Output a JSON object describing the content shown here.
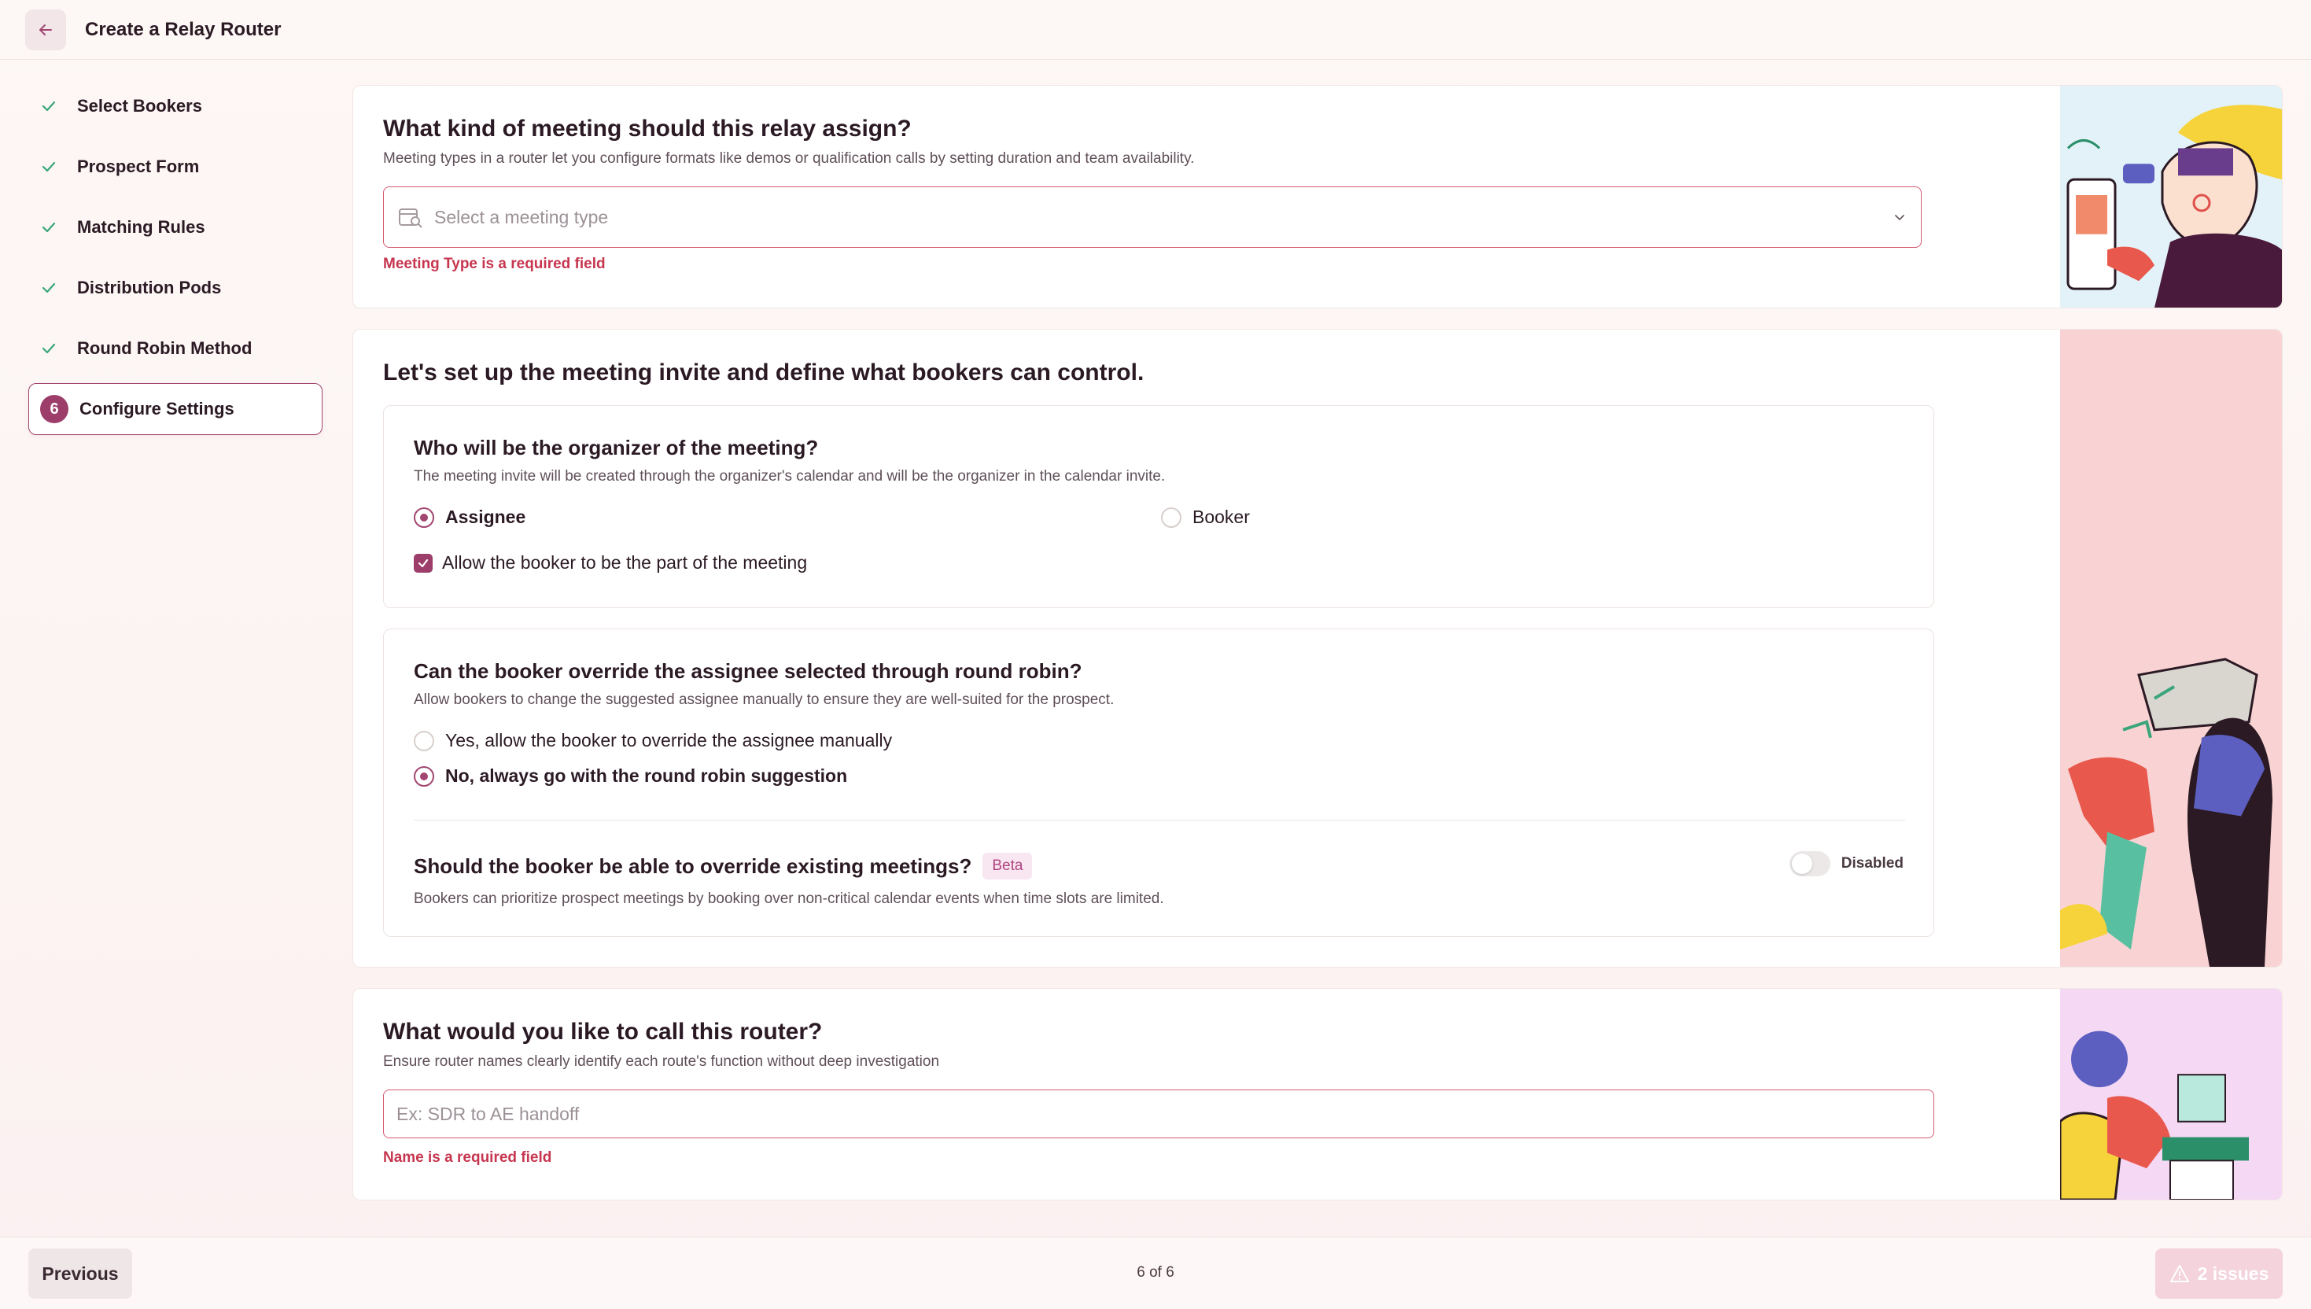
{
  "header": {
    "title": "Create a Relay Router"
  },
  "sidebar": {
    "steps": [
      {
        "label": "Select Bookers",
        "status": "done"
      },
      {
        "label": "Prospect Form",
        "status": "done"
      },
      {
        "label": "Matching Rules",
        "status": "done"
      },
      {
        "label": "Distribution Pods",
        "status": "done"
      },
      {
        "label": "Round Robin Method",
        "status": "done"
      },
      {
        "label": "Configure Settings",
        "status": "active",
        "number": "6"
      }
    ]
  },
  "meeting_type": {
    "title": "What kind of meeting should this relay assign?",
    "subtitle": "Meeting types in a router let you configure formats like demos or qualification calls by setting duration and team availability.",
    "placeholder": "Select a meeting type",
    "error": "Meeting Type is a required field"
  },
  "invite": {
    "title": "Let's set up the meeting invite and define what bookers can control.",
    "organizer": {
      "title": "Who will be the organizer of the meeting?",
      "subtitle": "The meeting invite will be created through the organizer's calendar and will be the organizer in the calendar invite.",
      "options": [
        "Assignee",
        "Booker"
      ],
      "selected": "Assignee",
      "checkbox_label": "Allow the booker to be the part of the meeting",
      "checkbox_checked": true
    },
    "override": {
      "title": "Can the booker override the assignee selected through round robin?",
      "subtitle": "Allow bookers to change the suggested assignee manually to ensure they are well-suited for the prospect.",
      "options": [
        "Yes, allow the booker to override the assignee manually",
        "No, always go with the round robin suggestion"
      ],
      "selected": "No, always go with the round robin suggestion"
    },
    "existing": {
      "title": "Should the booker be able to override existing meetings?",
      "badge": "Beta",
      "subtitle": "Bookers can prioritize prospect meetings by booking over non-critical calendar events when time slots are limited.",
      "toggle_label": "Disabled",
      "toggle_on": false
    }
  },
  "name": {
    "title": "What would you like to call this router?",
    "subtitle": "Ensure router names clearly identify each route's function without deep investigation",
    "placeholder": "Ex: SDR to AE handoff",
    "value": "",
    "error": "Name is a required field"
  },
  "footer": {
    "previous_label": "Previous",
    "page_indicator": "6 of 6",
    "issues_label": "2 issues"
  },
  "colors": {
    "accent": "#9c3d6a",
    "error": "#c7364f",
    "issues_button": "#f4d3dd"
  }
}
